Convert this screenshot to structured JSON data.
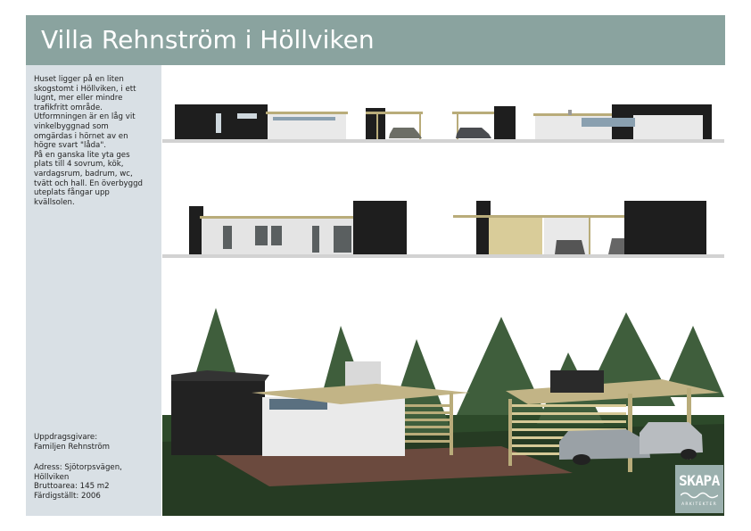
{
  "header": {
    "title": "Villa Rehnström i Höllviken"
  },
  "sidebar": {
    "description": "Huset ligger på en liten skogstomt i Höllviken, i ett lugnt, mer eller mindre trafikfritt område.\nUtformningen är en låg vit vinkelbyggnad som omgärdas i hörnet av en högre svart \"låda\".\nPå en ganska lite yta ges plats till 4 sovrum, kök, vardagsrum, badrum, wc, tvätt och hall. En överbyggd uteplats fångar upp kvällsolen.",
    "client_label": "Uppdragsgivare:",
    "client_value": "Familjen Rehnström",
    "address_label": "Adress:",
    "address_value": "Sjötorpsvägen, Höllviken",
    "area_label": "Bruttoarea:",
    "area_value": "145 m2",
    "completed_label": "Färdigställt:",
    "completed_value": "2006"
  },
  "logo": {
    "name": "SKAPA",
    "subtitle": "ARKITEKTER"
  },
  "colors": {
    "title_bar": "#8aa39f",
    "sidebar": "#d9e0e5",
    "logo": "#9bb0ae",
    "facade_black": "#1e1e1e",
    "facade_white": "#e9e9e9",
    "timber": "#b9ac7a"
  }
}
